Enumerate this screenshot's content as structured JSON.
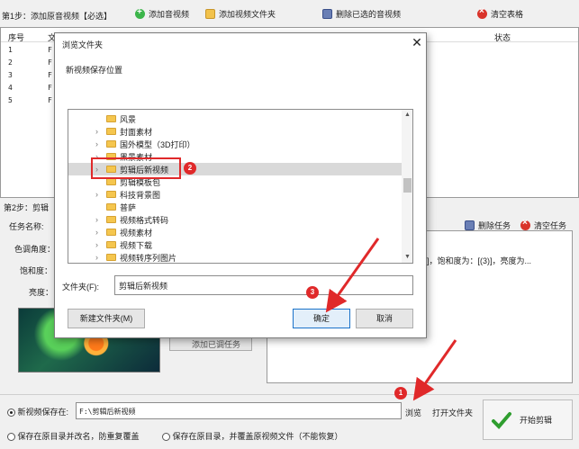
{
  "toolbar": {
    "step1_label": "第1步：添加原音视频【必选】",
    "add_video": "添加音视频",
    "add_folder": "添加视频文件夹",
    "delete_selected": "删除已选的音视频",
    "clear_table": "清空表格"
  },
  "table": {
    "col_index": "序号",
    "col_file": "文",
    "col_status": "状态",
    "rows": [
      {
        "index": "1",
        "file": "F"
      },
      {
        "index": "2",
        "file": "F"
      },
      {
        "index": "3",
        "file": "F"
      },
      {
        "index": "4",
        "file": "F"
      },
      {
        "index": "5",
        "file": "F"
      }
    ]
  },
  "step2": {
    "title": "第2步：剪辑",
    "task_name_label": "任务名称:",
    "hue_label": "色调角度：",
    "saturation_label": "饱和度：",
    "brightness_label": "亮度：",
    "delete_task": "删除任务",
    "clear_tasks": "清空任务",
    "task_text": "?]，饱和度为：[(3)]，亮度为...",
    "add_task_partial": "添加已调任务"
  },
  "bottom": {
    "save_new_label": "新视频保存在:",
    "save_path": "F:\\剪辑后新视频",
    "browse": "浏览",
    "open_folder": "打开文件夹",
    "start": "开始剪辑",
    "option_rename": "保存在原目录并改名，防重复覆盖",
    "option_overwrite": "保存在原目录，并覆盖原视频文件（不能恢复）"
  },
  "dialog": {
    "title": "浏览文件夹",
    "close": "✕",
    "description": "新视频保存位置",
    "tree_items": [
      {
        "label": "风景",
        "has_children": false,
        "selected": false
      },
      {
        "label": "封面素材",
        "has_children": true,
        "selected": false
      },
      {
        "label": "国外模型（3D打印）",
        "has_children": true,
        "selected": false
      },
      {
        "label": "黑景素材",
        "has_children": true,
        "selected": false
      },
      {
        "label": "剪辑后新视频",
        "has_children": true,
        "selected": true
      },
      {
        "label": "剪辑模板包",
        "has_children": false,
        "selected": false
      },
      {
        "label": "科技背景图",
        "has_children": true,
        "selected": false
      },
      {
        "label": "普萨",
        "has_children": false,
        "selected": false
      },
      {
        "label": "视频格式转码",
        "has_children": true,
        "selected": false
      },
      {
        "label": "视频素材",
        "has_children": true,
        "selected": false
      },
      {
        "label": "视频下载",
        "has_children": true,
        "selected": false
      },
      {
        "label": "视频转序列图片",
        "has_children": true,
        "selected": false
      }
    ],
    "folder_label": "文件夹(F):",
    "folder_value": "剪辑后新视频",
    "new_folder": "新建文件夹(M)",
    "ok": "确定",
    "cancel": "取消"
  },
  "annotations": {
    "badge1": "1",
    "badge2": "2",
    "badge3": "3",
    "accent_red": "#e0292a"
  }
}
